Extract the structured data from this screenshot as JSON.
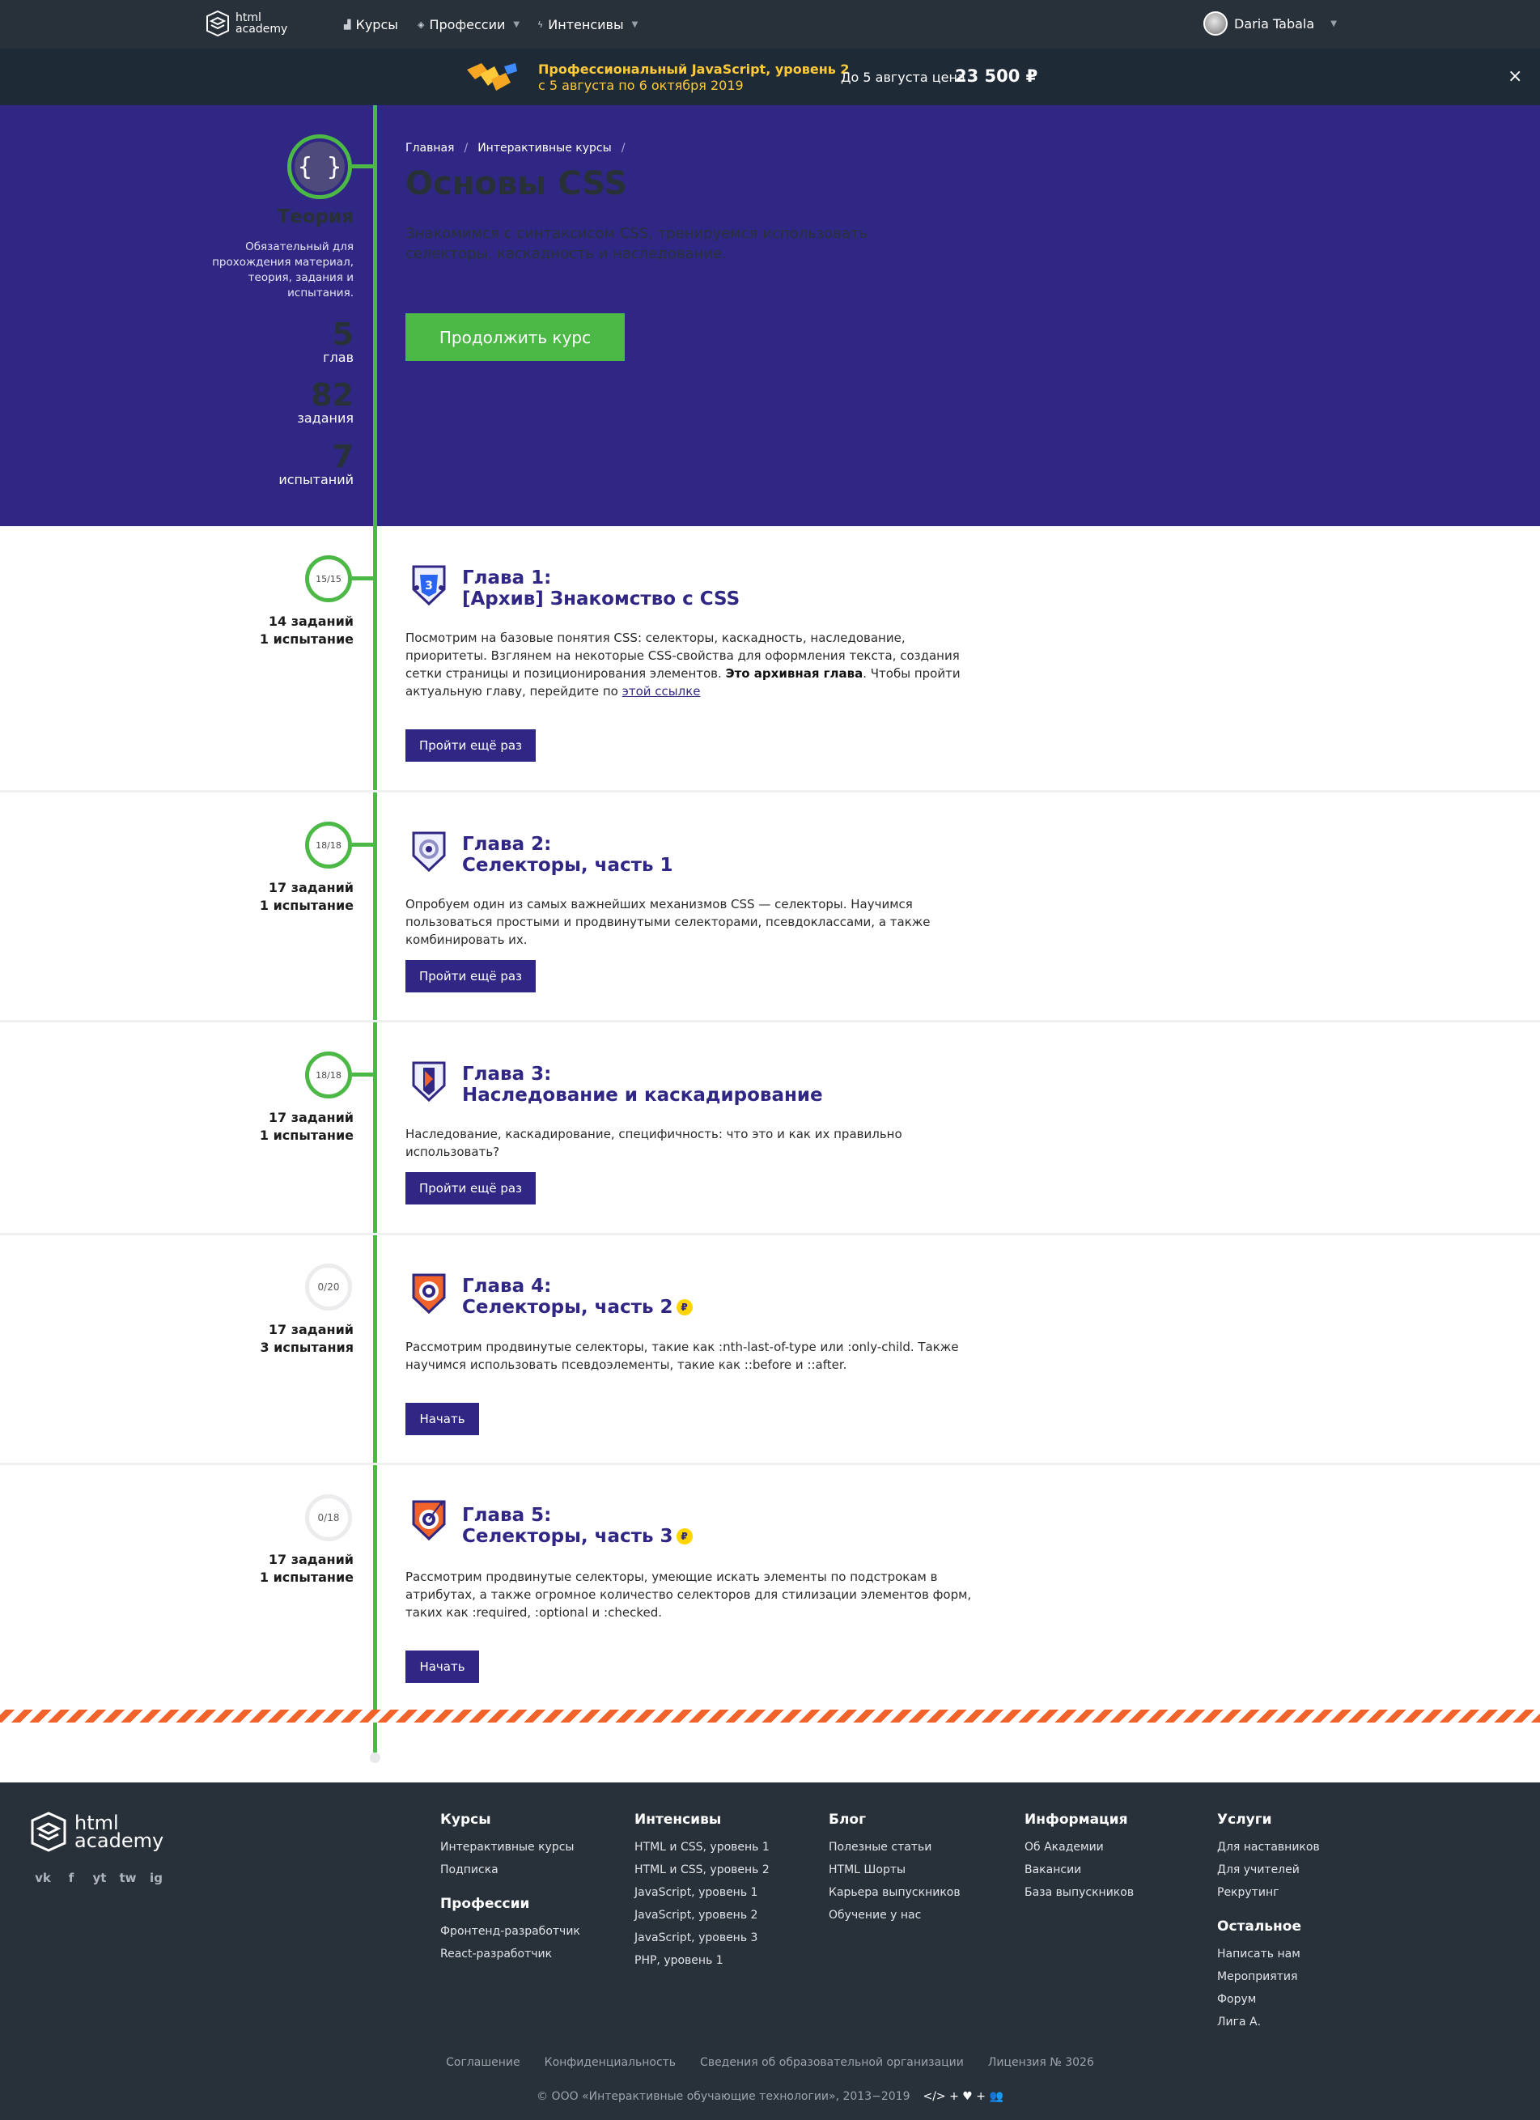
{
  "nav": {
    "logo": "html academy",
    "items": [
      {
        "label": "Курсы",
        "icon": "bar-chart-icon"
      },
      {
        "label": "Профессии",
        "icon": "layers-icon"
      },
      {
        "label": "Интенсивы",
        "icon": "lightning-icon"
      }
    ],
    "user": "Daria Tabala"
  },
  "promo": {
    "title": "Профессиональный JavaScript, уровень 2",
    "dates": "с 5 августа по 6 октября 2019",
    "price_label": "До 5 августа цена",
    "price": "23 500 ₽",
    "close": "×"
  },
  "hero": {
    "breadcrumb": [
      "Главная",
      "Интерактивные курсы"
    ],
    "breadcrumb_sep": "/",
    "title": "Основы CSS",
    "description": "Знакомимся с синтаксисом CSS, тренируемся использовать селекторы, каскадность и наследование.",
    "button": "Продолжить курс",
    "theory": {
      "title": "Теория",
      "description": "Обязательный для прохождения материал, теория, задания и испытания.",
      "icon_glyph": "{ }"
    },
    "stats": [
      {
        "value": "5",
        "label": "глав"
      },
      {
        "value": "82",
        "label": "задания"
      },
      {
        "value": "7",
        "label": "испытаний"
      }
    ]
  },
  "chapters": [
    {
      "progress": "15/15",
      "tasks": "14 заданий",
      "tests": "1 испытание",
      "title_line1": "Глава 1:",
      "title_line2": "[Архив] Знакомство с CSS",
      "paid": false,
      "desc_part1": "Посмотрим на базовые понятия CSS: селекторы, каскадность, наследование, приоритеты. Взглянем на некоторые CSS-свойства для оформления текста, создания сетки страницы и позиционирования элементов. ",
      "desc_bold": "Это архивная глава",
      "desc_part2": ". Чтобы пройти актуальную главу, перейдите по ",
      "desc_link": "этой ссылке",
      "button": "Пройти ещё раз",
      "done": true,
      "icon": "css3-shield-icon"
    },
    {
      "progress": "18/18",
      "tasks": "17 заданий",
      "tests": "1 испытание",
      "title_line1": "Глава 2:",
      "title_line2": "Селекторы, часть 1",
      "paid": false,
      "description": "Опробуем один из самых важнейших механизмов CSS — селекторы. Научимся пользоваться простыми и продвинутыми селекторами, псевдоклассами, а также комбинировать их.",
      "button": "Пройти ещё раз",
      "done": true,
      "icon": "target-shield-icon"
    },
    {
      "progress": "18/18",
      "tasks": "17 заданий",
      "tests": "1 испытание",
      "title_line1": "Глава 3:",
      "title_line2": "Наследование и каскадирование",
      "paid": false,
      "description": "Наследование, каскадирование, специфичность: что это и как их правильно использовать?",
      "button": "Пройти ещё раз",
      "done": true,
      "icon": "cascade-shield-icon"
    },
    {
      "progress": "0/20",
      "tasks": "17 заданий",
      "tests": "3 испытания",
      "title_line1": "Глава 4:",
      "title_line2": "Селекторы, часть 2",
      "paid": true,
      "description": "Рассмотрим продвинутые селекторы, такие как :nth-last-of-type или :only-child. Также научимся использовать псевдоэлементы, такие как ::before и ::after.",
      "button": "Начать",
      "done": false,
      "icon": "target-orange-shield-icon"
    },
    {
      "progress": "0/18",
      "tasks": "17 заданий",
      "tests": "1 испытание",
      "title_line1": "Глава 5:",
      "title_line2": "Селекторы, часть 3",
      "paid": true,
      "description": "Рассмотрим продвинутые селекторы, умеющие искать элементы по подстрокам в атрибутах, а также огромное количество селекторов для стилизации элементов форм, таких как :required, :optional и :checked.",
      "button": "Начать",
      "done": false,
      "icon": "target-arrow-shield-icon"
    }
  ],
  "paid_badge": "₽",
  "footer": {
    "logo": "html academy",
    "social": [
      "vk",
      "f",
      "yt",
      "tw",
      "ig"
    ],
    "columns": [
      {
        "title": "Курсы",
        "items": [
          "Интерактивные курсы",
          "Подписка"
        ]
      },
      {
        "title": "Профессии",
        "items": [
          "Фронтенд-разработчик",
          "React-разработчик"
        ]
      },
      {
        "title": "Интенсивы",
        "items": [
          "HTML и CSS, уровень 1",
          "HTML и CSS, уровень 2",
          "JavaScript, уровень 1",
          "JavaScript, уровень 2",
          "JavaScript, уровень 3",
          "PHP, уровень 1"
        ]
      },
      {
        "title": "Блог",
        "items": [
          "Полезные статьи",
          "HTML Шорты",
          "Карьера выпускников",
          "Обучение у нас"
        ]
      },
      {
        "title": "Информация",
        "items": [
          "Об Академии",
          "Вакансии",
          "База выпускников"
        ]
      },
      {
        "title": "Услуги",
        "items": [
          "Для наставников",
          "Для учителей",
          "Рекрутинг"
        ]
      },
      {
        "title": "Остальное",
        "items": [
          "Написать нам",
          "Мероприятия",
          "Форум",
          "Лига А."
        ]
      }
    ],
    "legal": [
      "Соглашение",
      "Конфиденциальность",
      "Сведения об образовательной организации",
      "Лицензия № 3026"
    ],
    "copyright": "© ООО «Интерактивные обучающие технологии», 2013−2019",
    "made_with": "</> + ♥ + 👥"
  },
  "colors": {
    "brand_purple": "#302784",
    "accent_green": "#4cb846",
    "promo_yellow": "#ffca3a",
    "stripe_orange": "#f2632b",
    "dark": "#283039"
  }
}
